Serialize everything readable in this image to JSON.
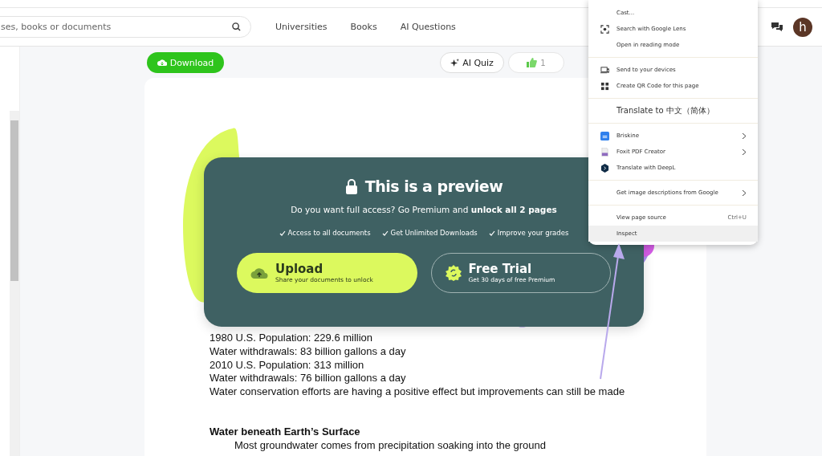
{
  "header": {
    "search": {
      "placeholder": "ses, books or documents"
    },
    "nav": [
      "Universities",
      "Books",
      "AI Questions"
    ],
    "avatar": "h"
  },
  "toolbar": {
    "download": "Download",
    "ai_quiz": "AI Quiz",
    "likes": "1"
  },
  "document": {
    "paragraphs": [
      {
        "kind": "line",
        "text": "1980 U.S. Population: 229.6 million"
      },
      {
        "kind": "line",
        "text": "Water withdrawals: 83 billion gallons a day"
      },
      {
        "kind": "line",
        "text": "2010 U.S. Population: 313 million"
      },
      {
        "kind": "line",
        "text": "Water withdrawals: 76 billion gallons a day"
      },
      {
        "kind": "line",
        "text": "Water conservation efforts are having a positive effect but improvements can still be made"
      },
      {
        "kind": "heading",
        "text": "Water beneath Earth’s Surface"
      },
      {
        "kind": "indented",
        "text": "Most groundwater comes from precipitation soaking into the ground"
      }
    ]
  },
  "preview": {
    "title": "This is a preview",
    "subtitle": "Do you want full access? Go Premium and **unlock all 2 pages**",
    "benefits": [
      "Access to all documents",
      "Get Unlimited Downloads",
      "Improve your grades"
    ],
    "actions": [
      {
        "kind": "primary",
        "title": "Upload",
        "subtitle": "Share your documents to unlock"
      },
      {
        "kind": "outline",
        "title": "Free Trial",
        "subtitle": "Get 30 days of free Premium"
      }
    ]
  },
  "context_menu": {
    "sections": [
      {
        "items": [
          {
            "label": "Cast...",
            "hovered": false
          },
          {
            "label": "Search with Google Lens",
            "hovered": false
          },
          {
            "label": "Open in reading mode",
            "hovered": false
          }
        ]
      },
      {
        "items": [
          {
            "label": "Send to your devices",
            "hovered": false
          },
          {
            "label": "Create QR Code for this page",
            "hovered": false
          }
        ]
      },
      {
        "items": [
          {
            "label": "Translate to 中文（简体）",
            "hovered": false
          }
        ]
      },
      {
        "items": [
          {
            "label": "Briskine",
            "hovered": false,
            "submenu": true
          },
          {
            "label": "Foxit PDF Creator",
            "hovered": false,
            "submenu": true
          },
          {
            "label": "Translate with DeepL",
            "hovered": false
          }
        ]
      },
      {
        "items": [
          {
            "label": "Get image descriptions from Google",
            "hovered": false,
            "submenu": true
          }
        ]
      },
      {
        "items": [
          {
            "label": "View page source",
            "hovered": false,
            "shortcut": "Ctrl+U"
          },
          {
            "label": "Inspect",
            "hovered": true
          }
        ]
      }
    ]
  }
}
